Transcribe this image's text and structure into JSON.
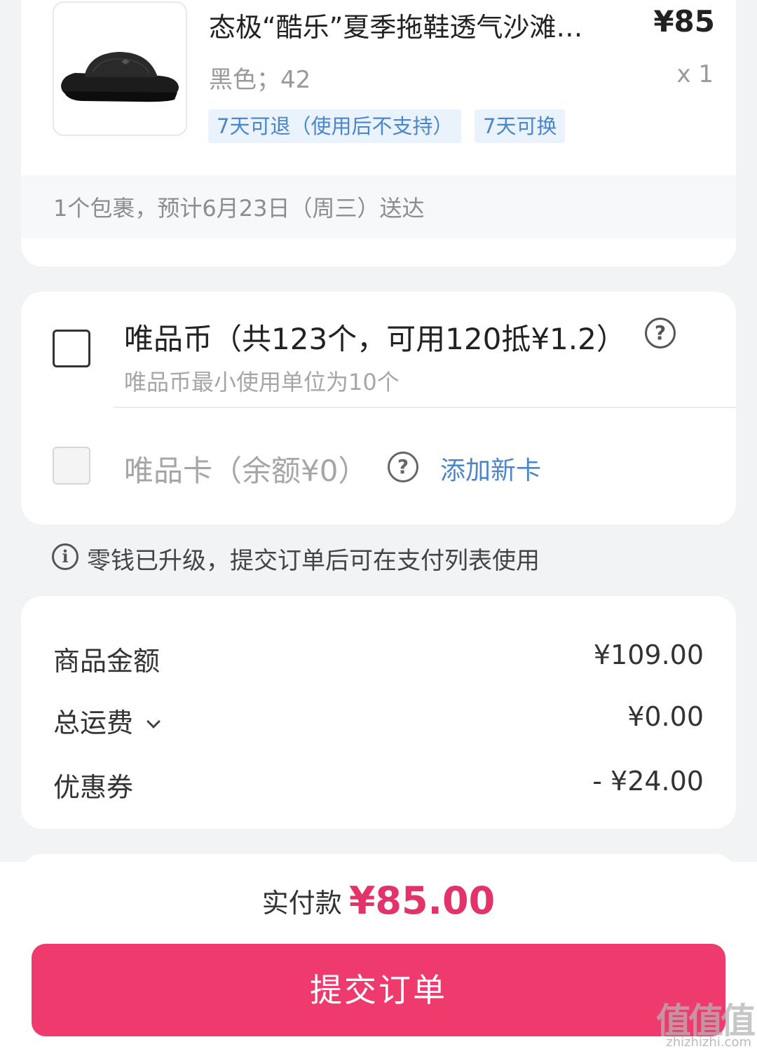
{
  "product": {
    "title": "态极“酷乐”夏季拖鞋透气沙滩…",
    "price": "¥85",
    "spec": "黑色；42",
    "quantity": "x 1",
    "tags": [
      "7天可退（使用后不支持）",
      "7天可换"
    ],
    "delivery": "1个包裹，预计6月23日（周三）送达"
  },
  "payment_options": {
    "coin_title": "唯品币（共123个，可用120抵¥1.2）",
    "coin_subtitle": "唯品币最小使用单位为10个",
    "coin_checked": false,
    "card_title": "唯品卡（余额¥0）",
    "card_enabled": false,
    "add_card_label": "添加新卡",
    "help_glyph": "?"
  },
  "notice": {
    "icon_glyph": "i",
    "text": "零钱已升级，提交订单后可在支付列表使用"
  },
  "summary": {
    "rows": [
      {
        "label": "商品金额",
        "value": "¥109.00"
      },
      {
        "label": "总运费",
        "value": "¥0.00"
      },
      {
        "label": "优惠券",
        "value": "- ¥24.00"
      }
    ]
  },
  "footer": {
    "total_label": "实付款",
    "total_amount": "¥85.00",
    "submit_label": "提交订单"
  },
  "watermark": {
    "logo": "值值值",
    "site": "zhizhizhi.com"
  },
  "colors": {
    "accent": "#ef3a6e",
    "price_red": "#e2346a",
    "link_blue": "#4a86c9",
    "tag_bg": "#eaf2fc"
  },
  "icons": [
    "sandal-product-image",
    "question-circle-icon",
    "info-circle-icon",
    "chevron-down-icon"
  ]
}
